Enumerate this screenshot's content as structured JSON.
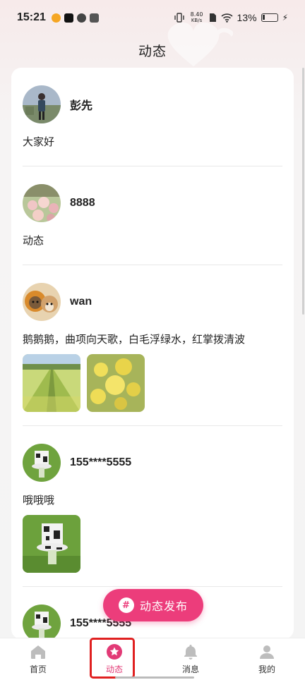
{
  "status_bar": {
    "time": "15:21",
    "net_speed_value": "8.40",
    "net_speed_unit": "KB/s",
    "battery_percent": "13%"
  },
  "page_title": "动态",
  "posts": [
    {
      "username": "彭先",
      "text": "大家好",
      "photo_count": 0,
      "avatar": "man-outdoors-avatar"
    },
    {
      "username": "8888",
      "text": "动态",
      "photo_count": 0,
      "avatar": "flowers-avatar"
    },
    {
      "username": "wan",
      "text": "鹅鹅鹅，曲项向天歌，白毛浮绿水，红掌拨清波",
      "photo_count": 2,
      "photos": [
        "canola-field-photo",
        "yellow-flowers-photo"
      ],
      "avatar": "dogs-avatar"
    },
    {
      "username": "155****5555",
      "text": "哦哦哦",
      "photo_count": 1,
      "photos": [
        "cow-figure-photo"
      ],
      "avatar": "cow-figure-avatar"
    },
    {
      "username": "155****5555",
      "avatar": "cow-figure-avatar"
    }
  ],
  "publish_button": {
    "label": "动态发布",
    "icon": "hash-icon",
    "color": "#ec3d7b"
  },
  "tabbar": {
    "tabs": [
      {
        "label": "首页",
        "icon": "home-icon"
      },
      {
        "label": "动态",
        "icon": "star-icon",
        "active": true
      },
      {
        "label": "消息",
        "icon": "bell-icon"
      },
      {
        "label": "我的",
        "icon": "user-icon"
      }
    ],
    "active_color": "#e23a76"
  }
}
